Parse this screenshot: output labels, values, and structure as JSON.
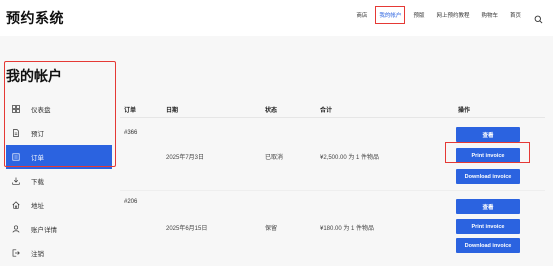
{
  "header": {
    "site_title": "预约系统",
    "nav": [
      "商店",
      "我的帐户",
      "预版",
      "网上预约教程",
      "购物车",
      "首页"
    ],
    "active_nav_index": 1,
    "search_icon": "search-icon"
  },
  "sidebar": {
    "title": "我的帐户",
    "items": [
      {
        "label": "仪表盘",
        "icon": "dashboard-icon"
      },
      {
        "label": "预订",
        "icon": "document-icon"
      },
      {
        "label": "订单",
        "icon": "orders-icon",
        "active": true
      },
      {
        "label": "下载",
        "icon": "download-icon"
      },
      {
        "label": "地址",
        "icon": "home-icon"
      },
      {
        "label": "账户详情",
        "icon": "user-icon"
      },
      {
        "label": "注销",
        "icon": "logout-icon"
      }
    ]
  },
  "table": {
    "headers": [
      "订单",
      "日期",
      "状态",
      "合计",
      "操作"
    ],
    "rows": [
      {
        "order": "#366",
        "date": "2025年7月3日",
        "status": "已取消",
        "total": "¥2,500.00 为 1 件物品",
        "actions": [
          "查看",
          "Print invoice",
          "Download invoice"
        ]
      },
      {
        "order": "#206",
        "date": "2025年6月15日",
        "status": "保留",
        "total": "¥180.00 为 1 件物品",
        "actions": [
          "查看",
          "Print invoice",
          "Download invoice"
        ]
      }
    ]
  },
  "colors": {
    "accent": "#2b63e0",
    "highlight": "#e53935"
  }
}
